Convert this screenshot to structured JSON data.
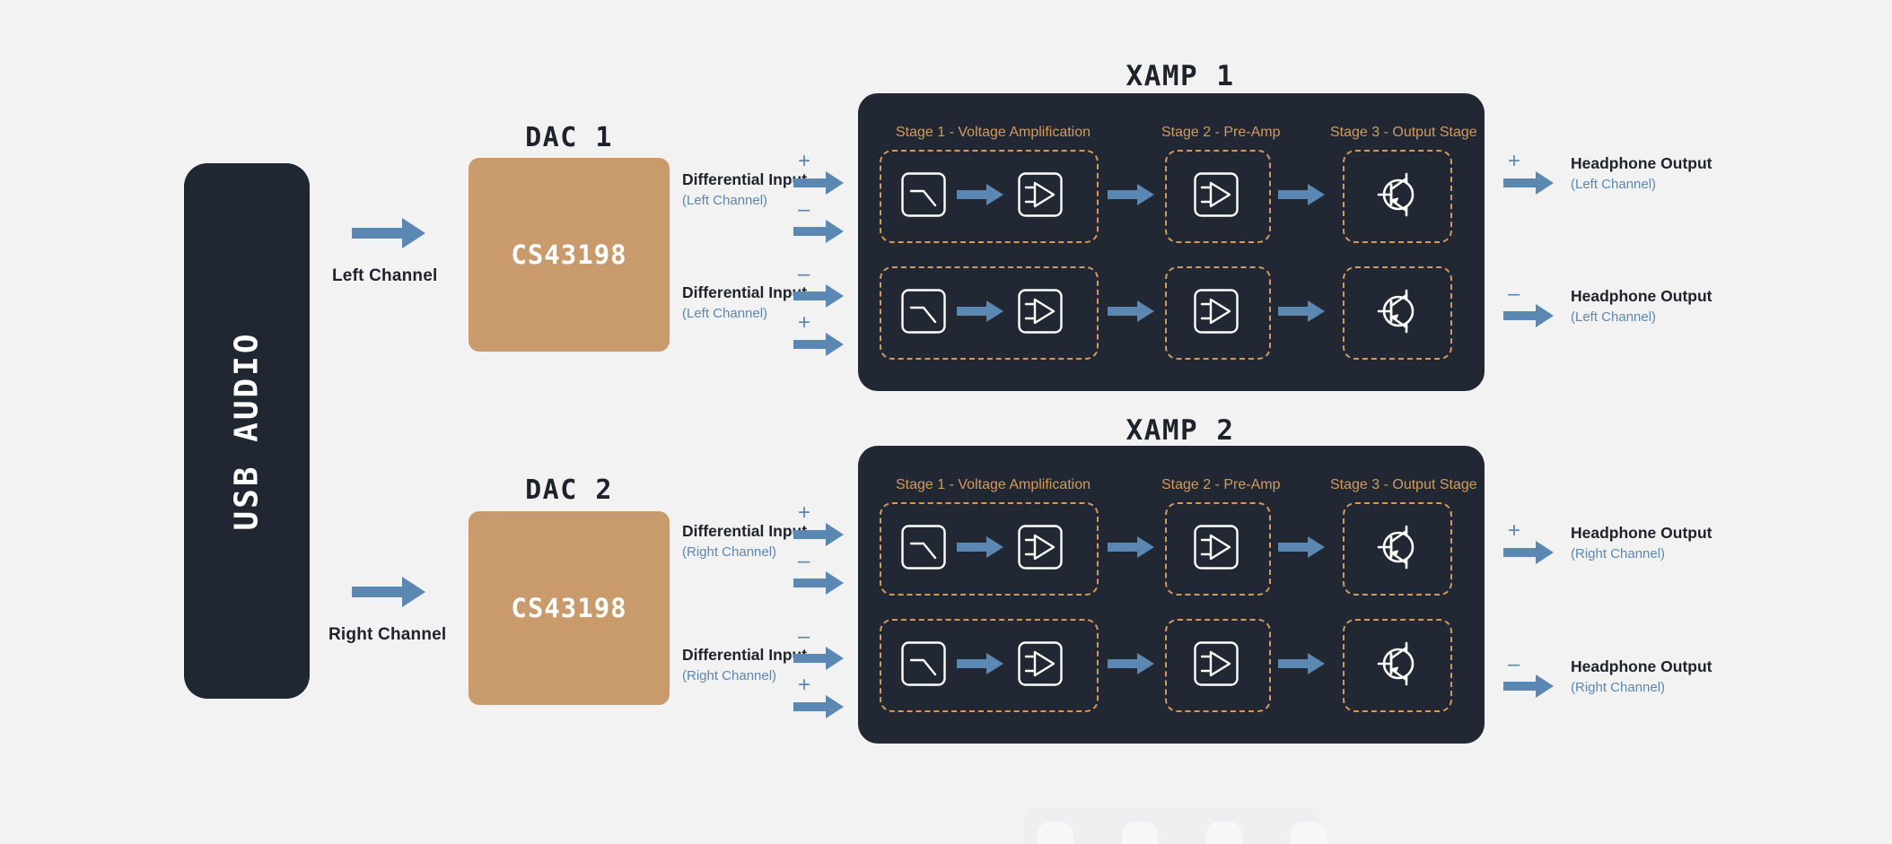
{
  "colors": {
    "background": "#f2f2f3",
    "dark_panel": "#222833",
    "usb_box": "#202632",
    "dac_fill": "#c99a6b",
    "arrow_blue": "#5b87b3",
    "stage_orange": "#d29a5e",
    "text_dark": "#1d222b",
    "text_white": "#ffffff"
  },
  "source": {
    "label": "USB AUDIO"
  },
  "channels": [
    {
      "name": "left-channel",
      "label": "Left Channel"
    },
    {
      "name": "right-channel",
      "label": "Right Channel"
    }
  ],
  "dacs": [
    {
      "title": "DAC 1",
      "chip": "CS43198"
    },
    {
      "title": "DAC 2",
      "chip": "CS43198"
    }
  ],
  "differential_inputs": [
    {
      "title": "Differential Input",
      "channel": "(Left Channel)",
      "signs": [
        "+",
        "–"
      ]
    },
    {
      "title": "Differential Input",
      "channel": "(Left Channel)",
      "signs": [
        "–",
        "+"
      ]
    },
    {
      "title": "Differential Input",
      "channel": "(Right Channel)",
      "signs": [
        "+",
        "–"
      ]
    },
    {
      "title": "Differential Input",
      "channel": "(Right Channel)",
      "signs": [
        "–",
        "+"
      ]
    }
  ],
  "amps": [
    {
      "title": "XAMP 1",
      "stages": [
        {
          "label": "Stage 1  - Voltage Amplification",
          "icons": [
            "filter-icon",
            "opamp-icon"
          ]
        },
        {
          "label": "Stage 2 - Pre-Amp",
          "icons": [
            "opamp-icon"
          ]
        },
        {
          "label": "Stage 3 - Output Stage",
          "icons": [
            "transistor-icon"
          ]
        }
      ]
    },
    {
      "title": "XAMP 2",
      "stages": [
        {
          "label": "Stage 1  - Voltage Amplification",
          "icons": [
            "filter-icon",
            "opamp-icon"
          ]
        },
        {
          "label": "Stage 2 - Pre-Amp",
          "icons": [
            "opamp-icon"
          ]
        },
        {
          "label": "Stage 3 - Output Stage",
          "icons": [
            "transistor-icon"
          ]
        }
      ]
    }
  ],
  "outputs": [
    {
      "title": "Headphone Output",
      "channel": "(Left Channel)",
      "sign": "+"
    },
    {
      "title": "Headphone Output",
      "channel": "(Left Channel)",
      "sign": "–"
    },
    {
      "title": "Headphone Output",
      "channel": "(Right Channel)",
      "sign": "+"
    },
    {
      "title": "Headphone Output",
      "channel": "(Right Channel)",
      "sign": "–"
    }
  ]
}
